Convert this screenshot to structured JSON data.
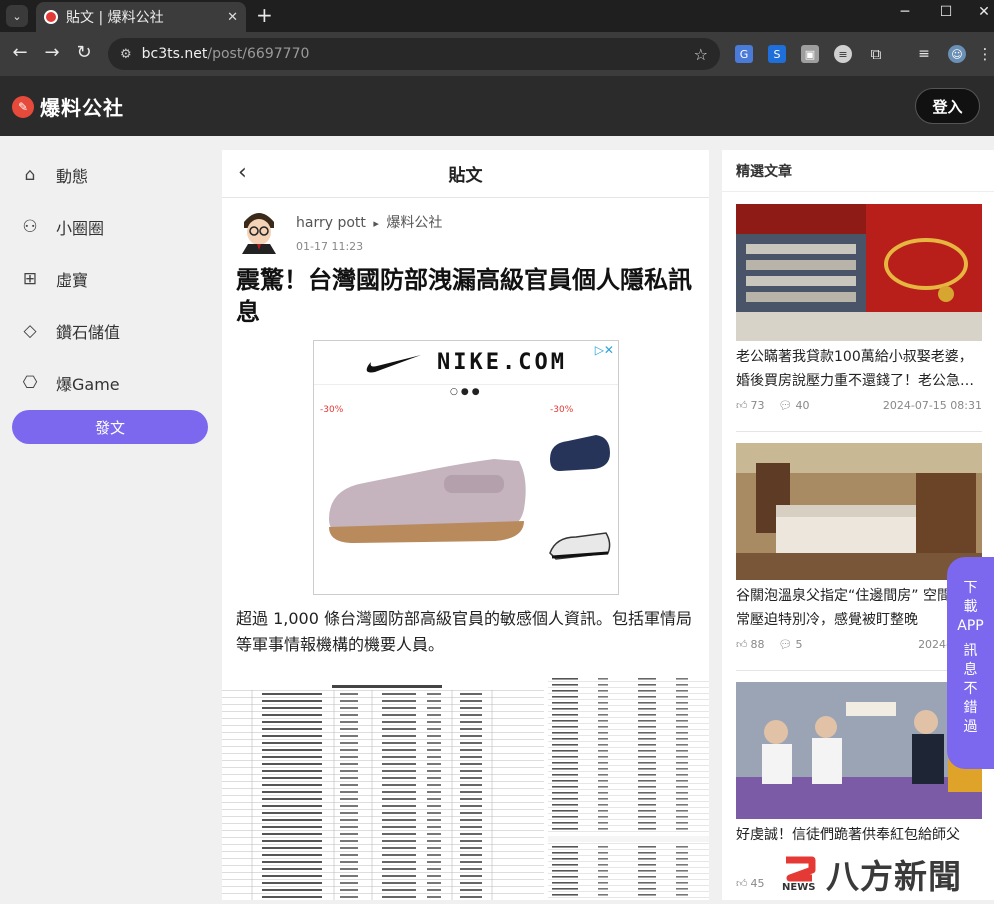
{
  "browser": {
    "tab_title": "貼文 | 爆料公社",
    "tab_close": "✕",
    "new_tab": "+",
    "url_host": "bc3ts.net",
    "url_path": "/post/6697770"
  },
  "site": {
    "logo_text": "爆料公社",
    "login_label": "登入"
  },
  "nav": {
    "items": [
      {
        "label": "動態",
        "icon": "home-icon"
      },
      {
        "label": "小圈圈",
        "icon": "group-icon"
      },
      {
        "label": "虛寶",
        "icon": "store-icon"
      },
      {
        "label": "鑽石儲值",
        "icon": "diamond-icon"
      },
      {
        "label": "爆Game",
        "icon": "gamepad-icon"
      }
    ],
    "post_button": "發文"
  },
  "post": {
    "header_title": "貼文",
    "author": "harry pott",
    "arrow": "▸",
    "board": "爆料公社",
    "time": "01-17 11:23",
    "title": "震驚！台灣國防部洩漏高級官員個人隱私訊息",
    "body": "超過 1,000 條台灣國防部高級官員的敏感個人資訊。包括軍情局等軍事情報機構的機要人員。"
  },
  "ad": {
    "brand": "NIKE.COM",
    "dots": "○●●",
    "discount_1": "-30%",
    "discount_2": "-30%"
  },
  "sidebar": {
    "title": "精選文章",
    "articles": [
      {
        "title": "老公瞞著我貸款100萬給小叔娶老婆，婚後買房說壓力重不還錢了！老公急…",
        "likes": "73",
        "comments": "40",
        "date": "2024-07-15 08:31"
      },
      {
        "title": "谷關泡溫泉父指定“住邊間房” 空間卻異常壓迫特別冷，感覺被盯整晚",
        "likes": "88",
        "comments": "5",
        "date": "2024-08-24"
      },
      {
        "title": "好虔誠！信徒們跪著供奉紅包給師父",
        "likes": "45",
        "comments": "",
        "date": ""
      }
    ]
  },
  "floating": {
    "app_text_1": "下",
    "app_text_2": "載",
    "app_text_3": "APP",
    "app_text_4": "訊",
    "app_text_5": "息",
    "app_text_6": "不",
    "app_text_7": "錯",
    "app_text_8": "過"
  },
  "watermark": {
    "text": "八方新聞",
    "small": "NEWS"
  },
  "colors": {
    "accent": "#7b68ee",
    "header_bg": "#2b2b2b"
  }
}
